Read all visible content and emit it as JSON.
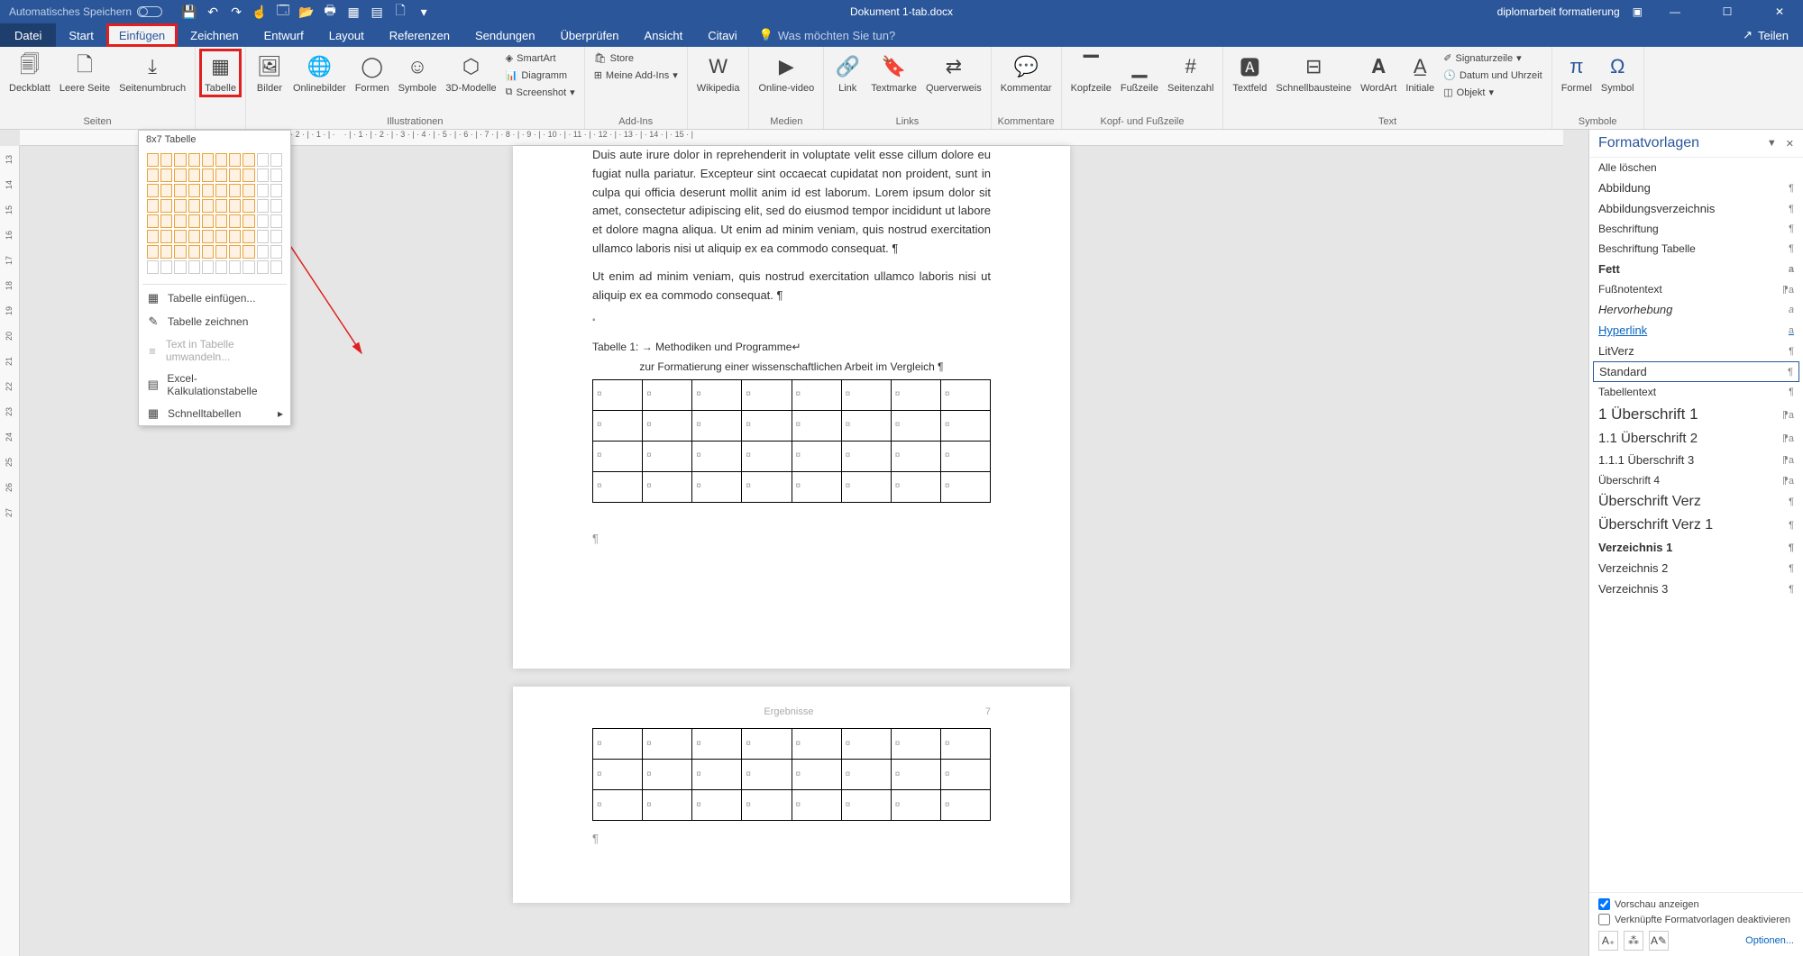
{
  "titlebar": {
    "autosave": "Automatisches Speichern",
    "doc_title": "Dokument 1-tab.docx",
    "user": "diplomarbeit formatierung"
  },
  "tabs": {
    "file": "Datei",
    "start": "Start",
    "insert": "Einfügen",
    "draw": "Zeichnen",
    "design": "Entwurf",
    "layout": "Layout",
    "references": "Referenzen",
    "mailings": "Sendungen",
    "review": "Überprüfen",
    "view": "Ansicht",
    "citavi": "Citavi",
    "tellme": "Was möchten Sie tun?",
    "share": "Teilen"
  },
  "ribbon": {
    "groups": {
      "pages": "Seiten",
      "illustrations": "Illustrationen",
      "addins": "Add-Ins",
      "media": "Medien",
      "links": "Links",
      "comments": "Kommentare",
      "headerfooter": "Kopf- und Fußzeile",
      "text": "Text",
      "symbols": "Symbole"
    },
    "buttons": {
      "cover": "Deckblatt",
      "blank": "Leere Seite",
      "pagebreak": "Seitenumbruch",
      "table": "Tabelle",
      "pictures": "Bilder",
      "online_pictures": "Onlinebilder",
      "shapes": "Formen",
      "symbols": "Symbole",
      "models": "3D-Modelle",
      "smartart": "SmartArt",
      "chart": "Diagramm",
      "screenshot": "Screenshot",
      "store": "Store",
      "myaddins": "Meine Add-Ins",
      "wikipedia": "Wikipedia",
      "onlinevideo": "Online-video",
      "link": "Link",
      "bookmark": "Textmarke",
      "crossref": "Querverweis",
      "comment": "Kommentar",
      "header": "Kopfzeile",
      "footer": "Fußzeile",
      "pagenumber": "Seitenzahl",
      "textbox": "Textfeld",
      "quickparts": "Schnellbausteine",
      "wordart": "WordArt",
      "dropcap": "Initiale",
      "signature": "Signaturzeile",
      "datetime": "Datum und Uhrzeit",
      "object": "Objekt",
      "equation": "Formel",
      "symbol": "Symbol"
    }
  },
  "table_dropdown": {
    "header": "8x7 Tabelle",
    "insert": "Tabelle einfügen...",
    "draw": "Tabelle zeichnen",
    "convert": "Text in Tabelle umwandeln...",
    "excel": "Excel-Kalkulationstabelle",
    "quick": "Schnelltabellen"
  },
  "doc": {
    "p1": "Duis aute irure dolor in reprehenderit in voluptate velit esse cillum dolore eu fugiat nulla pariatur. Excepteur sint occaecat cupidatat non proident, sunt in culpa qui officia deserunt mollit anim id est laborum. Lorem ipsum dolor sit amet, consectetur adipiscing elit, sed do eiusmod tempor incididunt ut labore et dolore magna aliqua. Ut enim ad minim veniam, quis nostrud exercitation ullamco laboris nisi ut aliquip ex ea commodo consequat. ¶",
    "p2": "Ut enim ad minim veniam, quis nostrud exercitation ullamco laboris nisi ut aliquip ex ea commodo consequat. ¶",
    "caption": "Tabelle 1: → Methodiken und Programme↵",
    "caption_sub": "zur Formatierung einer wissenschaftlichen Arbeit im Vergleich ¶",
    "header2": "Ergebnisse",
    "pagenum2": "7"
  },
  "styles": {
    "title": "Formatvorlagen",
    "clear": "Alle löschen",
    "items": [
      {
        "label": "Abbildung",
        "sym": "¶",
        "cls": ""
      },
      {
        "label": "Abbildungsverzeichnis",
        "sym": "¶",
        "cls": ""
      },
      {
        "label": "Beschriftung",
        "sym": "¶",
        "cls": "small"
      },
      {
        "label": "Beschriftung Tabelle",
        "sym": "¶",
        "cls": "small"
      },
      {
        "label": "Fett",
        "sym": "a",
        "cls": "bold"
      },
      {
        "label": "Fußnotentext",
        "sym": "⁋a",
        "cls": "small"
      },
      {
        "label": "Hervorhebung",
        "sym": "a",
        "cls": "italic"
      },
      {
        "label": "Hyperlink",
        "sym": "a",
        "cls": "link"
      },
      {
        "label": "LitVerz",
        "sym": "¶",
        "cls": ""
      },
      {
        "label": "Standard",
        "sym": "¶",
        "cls": "selected"
      },
      {
        "label": "Tabellentext",
        "sym": "¶",
        "cls": "small"
      },
      {
        "label": "1   Überschrift 1",
        "sym": "⁋a",
        "cls": "h1"
      },
      {
        "label": "1.1  Überschrift 2",
        "sym": "⁋a",
        "cls": "h2"
      },
      {
        "label": "1.1.1  Überschrift 3",
        "sym": "⁋a",
        "cls": "h3"
      },
      {
        "label": "Überschrift 4",
        "sym": "⁋a",
        "cls": "small"
      },
      {
        "label": "Überschrift Verz",
        "sym": "¶",
        "cls": "large"
      },
      {
        "label": "Überschrift Verz 1",
        "sym": "¶",
        "cls": "large"
      },
      {
        "label": "Verzeichnis 1",
        "sym": "¶",
        "cls": "bold"
      },
      {
        "label": "Verzeichnis 2",
        "sym": "¶",
        "cls": ""
      },
      {
        "label": "Verzeichnis 3",
        "sym": "¶",
        "cls": ""
      }
    ],
    "preview": "Vorschau anzeigen",
    "disable_linked": "Verknüpfte Formatvorlagen deaktivieren",
    "options": "Optionen..."
  }
}
